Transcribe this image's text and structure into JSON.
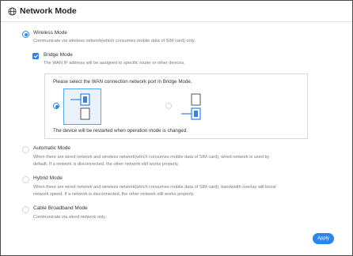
{
  "header": {
    "title": "Network Mode",
    "icon": "globe-icon"
  },
  "modes": {
    "wireless": {
      "label": "Wireless Mode",
      "desc": "Communicate via wireless network(which consumes mobile data of SIM card) only.",
      "selected": true
    },
    "bridge": {
      "label": "Bridge Mode",
      "desc": "The WAN IP address will be assigned to specific router or other devices.",
      "checked": true,
      "prompt": "Please select the WAN connection network port in Bridge Mode.",
      "note": "The device will be restarted when operation mode is changed."
    },
    "automatic": {
      "label": "Automatic Mode",
      "desc_line1": "When there are wired network and wireless network(which consumes mobile data of SIM card), wired network is used by",
      "desc_line2": "default. If a network is disconnected, the other network still works properly."
    },
    "hybrid": {
      "label": "Hybrid Mode",
      "desc_line1": "When there are wired network and wireless network(which consumes mobile data of SIM card), bandwidth overlay will boost",
      "desc_line2": "network speed. If a network is disconnected, the other network still works properly."
    },
    "cable": {
      "label": "Cable Broadband Mode",
      "desc": "Communicate via wired network only."
    }
  },
  "actions": {
    "apply_label": "Apply"
  },
  "colors": {
    "accent": "#2a86ea",
    "text": "#333333",
    "muted": "#777777"
  }
}
